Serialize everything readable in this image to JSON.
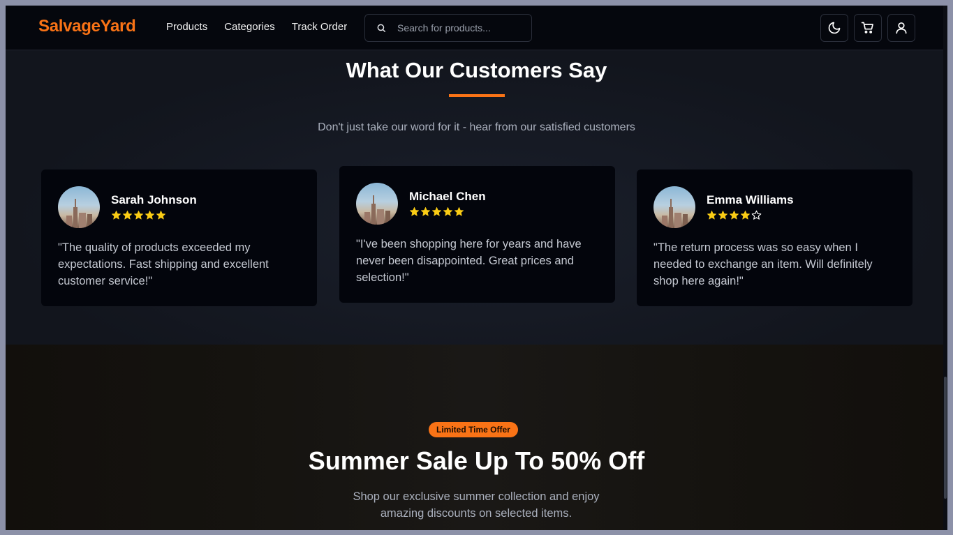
{
  "header": {
    "logo": "SalvageYard",
    "nav": [
      "Products",
      "Categories",
      "Track Order"
    ],
    "search_placeholder": "Search for products...",
    "icons": [
      "moon-icon",
      "cart-icon",
      "user-icon"
    ]
  },
  "testimonials": {
    "title": "What Our Customers Say",
    "subtitle": "Don't just take our word for it - hear from our satisfied customers",
    "accent_color": "#f97316",
    "star_color": "#facc15",
    "items": [
      {
        "name": "Sarah Johnson",
        "rating": 5,
        "quote": "\"The quality of products exceeded my expectations. Fast shipping and excellent customer service!\""
      },
      {
        "name": "Michael Chen",
        "rating": 5,
        "quote": "\"I've been shopping here for years and have never been disappointed. Great prices and selection!\""
      },
      {
        "name": "Emma Williams",
        "rating": 4,
        "quote": "\"The return process was so easy when I needed to exchange an item. Will definitely shop here again!\""
      }
    ]
  },
  "sale": {
    "badge": "Limited Time Offer",
    "title": "Summer Sale Up To 50% Off",
    "text": "Shop our exclusive summer collection and enjoy amazing discounts on selected items."
  }
}
